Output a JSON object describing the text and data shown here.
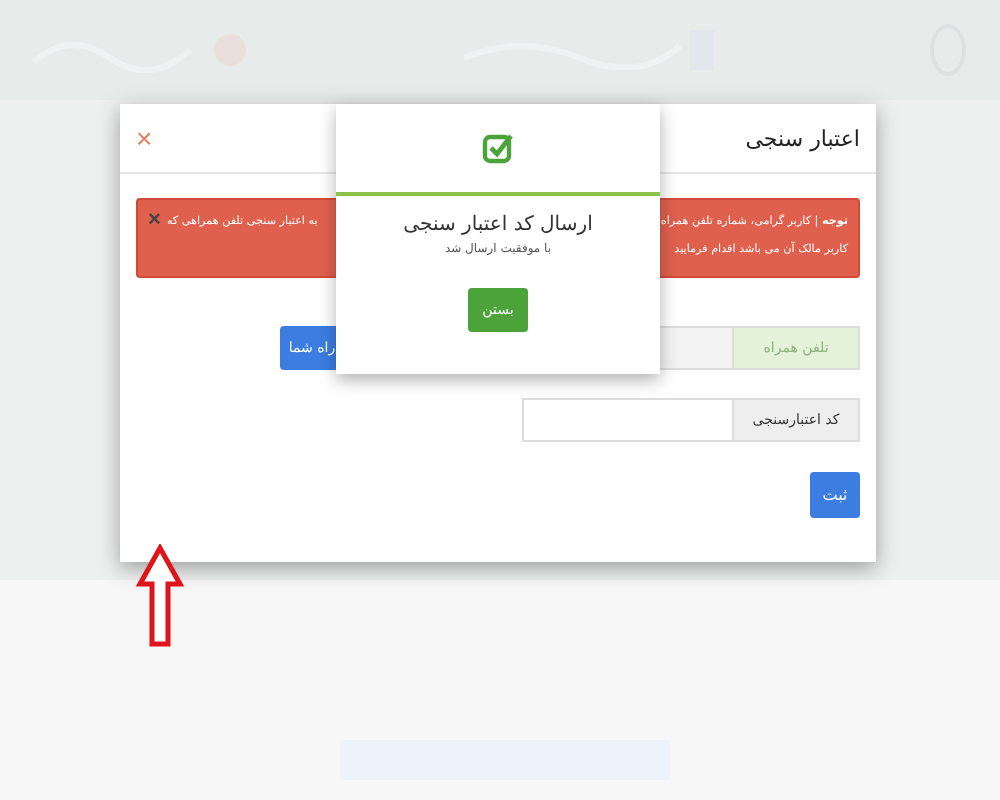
{
  "dialog": {
    "title": "اعتبار سنجی",
    "close": "×",
    "alert": {
      "lines_right": [
        "**توجه** | کاربر گرامی، شماره تلفن همراه",
        "کاربر مالک آن می باشد اقدام فرمایید"
      ],
      "text_left": "به اعتبار سنجی تلفن همراهی که",
      "dismiss": "×"
    },
    "fields": [
      {
        "label": "تلفن همراه",
        "disabled": true,
        "button": "راه شما"
      },
      {
        "label": "کد اعتبارسنجی",
        "disabled": false
      }
    ],
    "submit": "ثبت"
  },
  "popup": {
    "title": "ارسال کد اعتبار سنجی",
    "message": "با موفقیت ارسال شد",
    "button": "بستن"
  }
}
